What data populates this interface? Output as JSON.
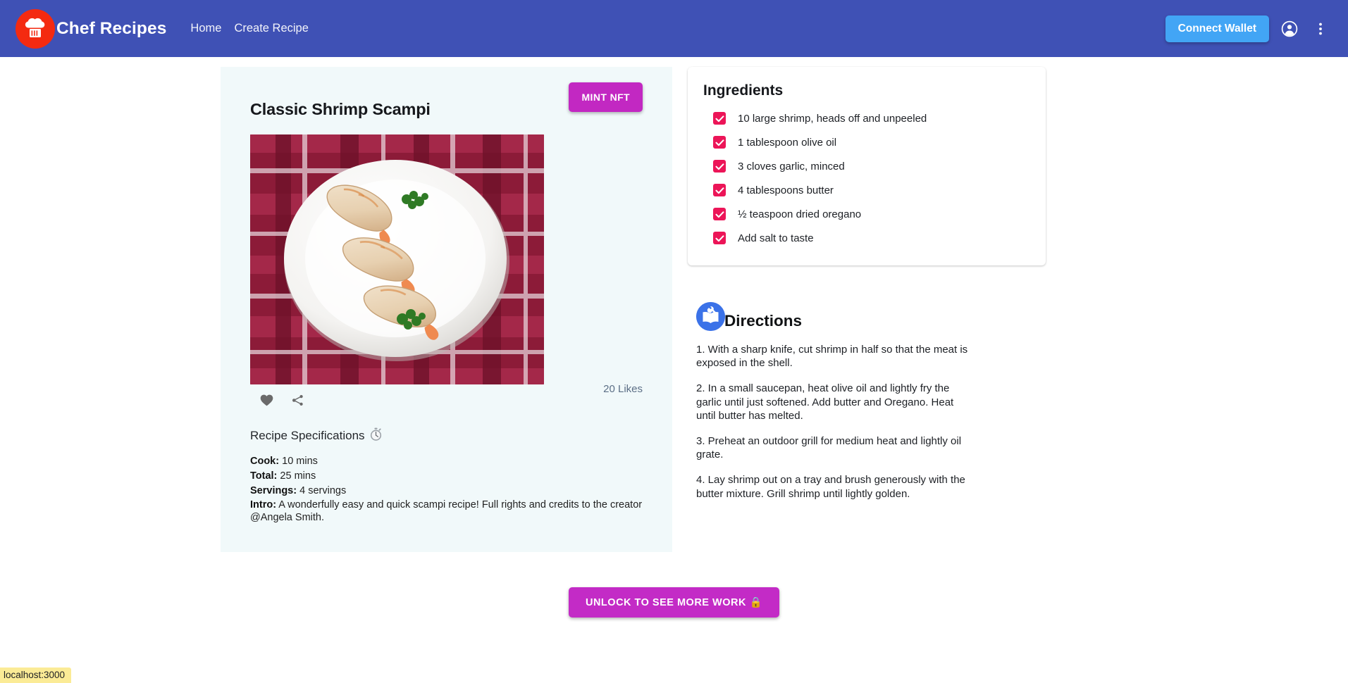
{
  "navbar": {
    "logo_icon": "chef-hat-icon",
    "brand": "Chef Recipes",
    "links": [
      {
        "label": "Home",
        "name": "nav-link-home"
      },
      {
        "label": "Create Recipe",
        "name": "nav-link-create-recipe"
      }
    ],
    "connect_wallet_label": "Connect Wallet",
    "account_icon": "account-circle-icon",
    "menu_icon": "more-vert-icon",
    "bg_color": "#3f51b5",
    "wallet_color": "#42a5f5"
  },
  "recipe": {
    "title": "Classic Shrimp Scampi",
    "mint_label": "MINT NFT",
    "mint_color": "#c228c2",
    "photo_alt": "grilled shrimp on a white oval plate over a red plaid cloth",
    "like_icon": "heart-icon",
    "share_icon": "share-icon",
    "likes_label": "20 Likes",
    "likes_count": 20,
    "spec_heading": "Recipe Specifications",
    "spec_icon": "stopwatch-icon",
    "specs": [
      {
        "label": "Cook:",
        "value": "10 mins"
      },
      {
        "label": "Total:",
        "value": "25 mins"
      },
      {
        "label": "Servings:",
        "value": "4 servings"
      },
      {
        "label": "Intro:",
        "value": "A wonderfully easy and quick scampi recipe! Full rights and credits to the creator @Angela Smith."
      }
    ],
    "card_bg": "#f1f9fa"
  },
  "ingredients": {
    "title": "Ingredients",
    "checkbox_color": "#ec1558",
    "items": [
      {
        "text": "10 large shrimp, heads off and unpeeled",
        "checked": true
      },
      {
        "text": "1 tablespoon olive oil",
        "checked": true
      },
      {
        "text": "3 cloves garlic, minced",
        "checked": true
      },
      {
        "text": "4 tablespoons butter",
        "checked": true
      },
      {
        "text": "½ teaspoon dried oregano",
        "checked": true
      },
      {
        "text": "Add salt to taste",
        "checked": true
      }
    ]
  },
  "directions": {
    "title": "Directions",
    "icon": "open-book-tool-icon",
    "icon_color": "#3b72e8",
    "steps": [
      "1. With a sharp knife, cut shrimp in half so that the meat is exposed in the shell.",
      "2. In a small saucepan, heat olive oil and lightly fry the garlic until just softened. Add butter and Oregano. Heat until butter has melted.",
      "3. Preheat an outdoor grill for medium heat and lightly oil grate.",
      "4. Lay shrimp out on a tray and brush generously with the butter mixture. Grill shrimp until lightly golden."
    ]
  },
  "footer": {
    "unlock_label": "UNLOCK TO SEE MORE WORK 🔒",
    "unlock_color": "#c32bc6"
  },
  "status_bar": {
    "text": "localhost:3000"
  }
}
